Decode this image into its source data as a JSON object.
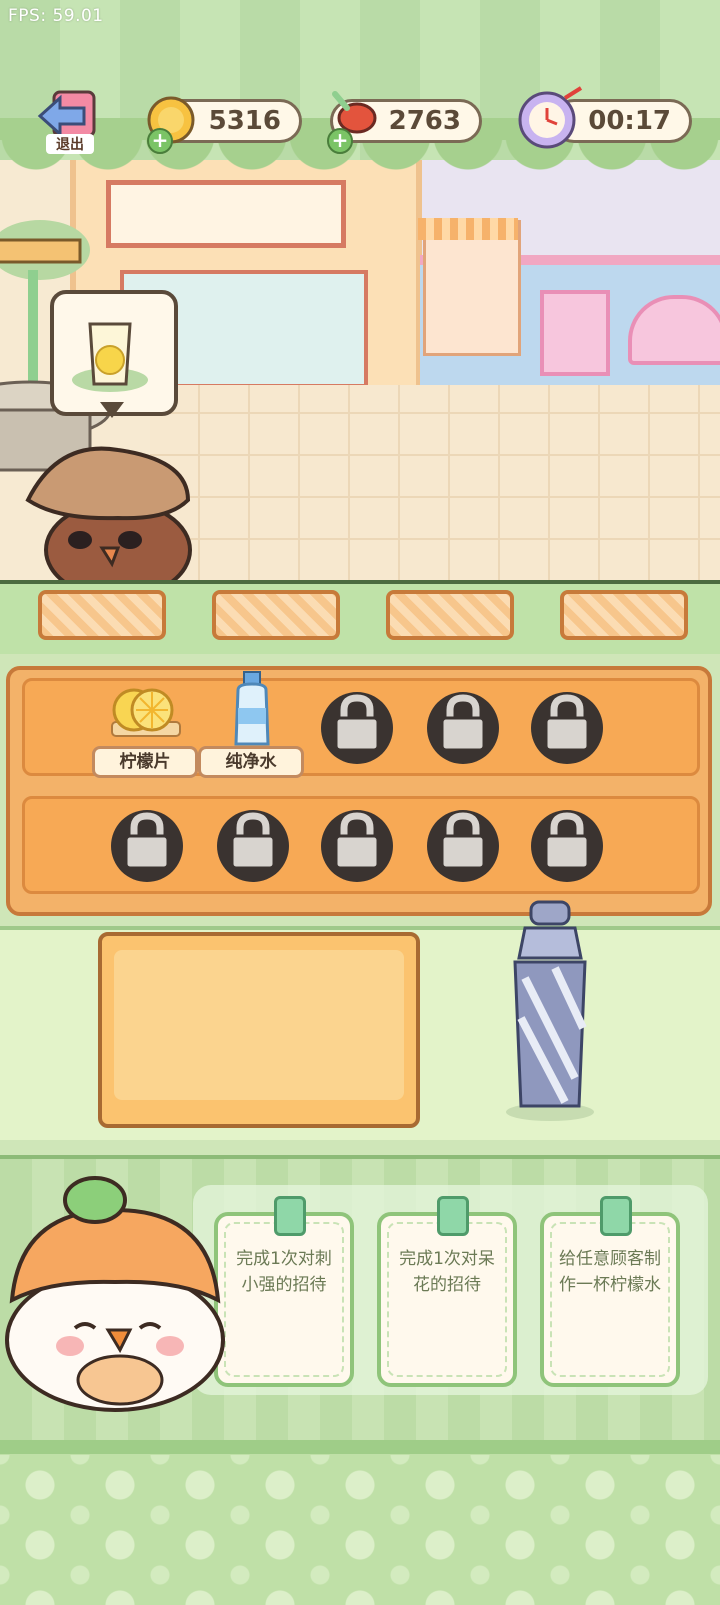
{
  "fps": "FPS: 59.01",
  "hud": {
    "exit_label": "退出",
    "coins": "5316",
    "meat": "2763",
    "timer": "00:17"
  },
  "customer": {
    "order_icon": "lemonade-glass-icon"
  },
  "ingredients": {
    "row1": [
      {
        "label": "柠檬片",
        "icon": "lemon-slices-icon",
        "locked": false
      },
      {
        "label": "纯净水",
        "icon": "water-bottle-icon",
        "locked": false
      },
      {
        "label": "",
        "icon": "lock-icon",
        "locked": true
      },
      {
        "label": "",
        "icon": "lock-icon",
        "locked": true
      },
      {
        "label": "",
        "icon": "lock-icon",
        "locked": true
      }
    ],
    "row2": [
      {
        "icon": "lock-icon",
        "locked": true
      },
      {
        "icon": "lock-icon",
        "locked": true
      },
      {
        "icon": "lock-icon",
        "locked": true
      },
      {
        "icon": "lock-icon",
        "locked": true
      },
      {
        "icon": "lock-icon",
        "locked": true
      }
    ]
  },
  "tasks": [
    {
      "text": "完成1次对刺小强的招待"
    },
    {
      "text": "完成1次对呆花的招待"
    },
    {
      "text": "给任意顾客制作一杯柠檬水"
    }
  ],
  "colors": {
    "accent_green": "#a6d08e",
    "counter_orange": "#f3b269",
    "hud_text": "#5b4a38"
  }
}
